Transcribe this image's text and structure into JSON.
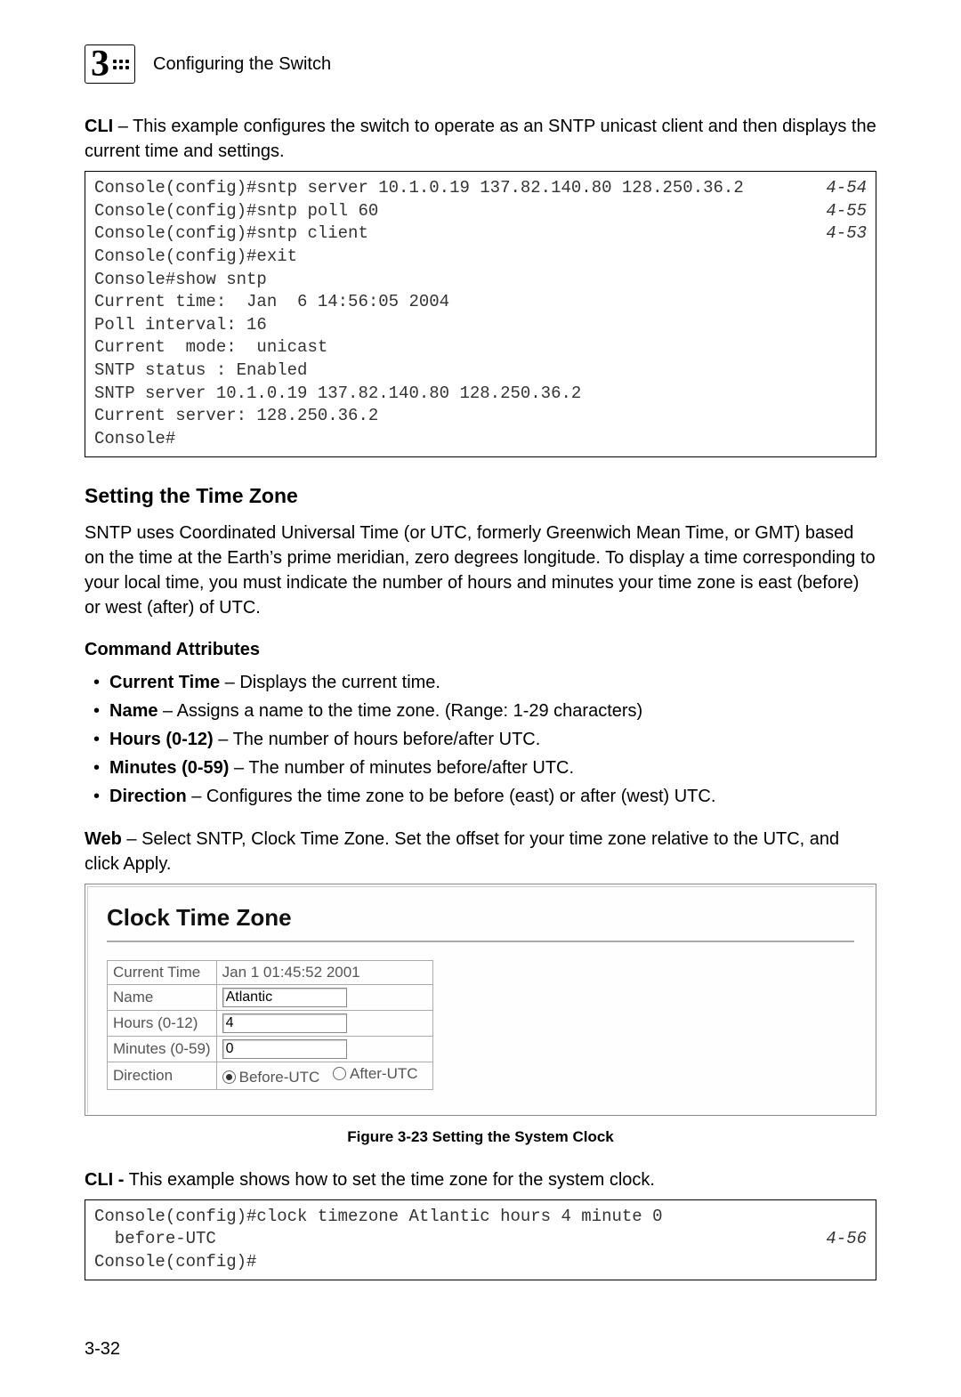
{
  "header": {
    "chapter_number": "3",
    "chapter_title": "Configuring the Switch"
  },
  "intro1_label": "CLI",
  "intro1_text": " – This example configures the switch to operate as an SNTP unicast client and then displays the current time and settings.",
  "code1": {
    "lines": [
      {
        "cmd": "Console(config)#sntp server 10.1.0.19 137.82.140.80 128.250.36.2",
        "ref": "4-54"
      },
      {
        "cmd": "Console(config)#sntp poll 60",
        "ref": "4-55"
      },
      {
        "cmd": "Console(config)#sntp client",
        "ref": "4-53"
      },
      {
        "cmd": "Console(config)#exit",
        "ref": ""
      },
      {
        "cmd": "Console#show sntp",
        "ref": ""
      },
      {
        "cmd": "Current time:  Jan  6 14:56:05 2004",
        "ref": ""
      },
      {
        "cmd": "Poll interval: 16",
        "ref": ""
      },
      {
        "cmd": "Current  mode:  unicast",
        "ref": ""
      },
      {
        "cmd": "SNTP status : Enabled",
        "ref": ""
      },
      {
        "cmd": "SNTP server 10.1.0.19 137.82.140.80 128.250.36.2",
        "ref": ""
      },
      {
        "cmd": "Current server: 128.250.36.2",
        "ref": ""
      },
      {
        "cmd": "Console#",
        "ref": ""
      }
    ]
  },
  "section_heading": "Setting the Time Zone",
  "section_body": "SNTP uses Coordinated Universal Time (or UTC, formerly Greenwich Mean Time, or GMT) based on the time at the Earth’s prime meridian, zero degrees longitude. To display a time corresponding to your local time, you must indicate the number of hours and minutes your time zone is east (before) or west (after) of UTC.",
  "attrs_heading": "Command Attributes",
  "attrs": [
    {
      "label": "Current Time",
      "text": " – Displays the current time."
    },
    {
      "label": "Name",
      "text": " – Assigns a name to the time zone. (Range: 1-29 characters)"
    },
    {
      "label": "Hours (0-12)",
      "text": " – The number of hours before/after UTC."
    },
    {
      "label": "Minutes (0-59)",
      "text": " – The number of minutes before/after UTC."
    },
    {
      "label": "Direction",
      "text": " – Configures the time zone to be before (east) or after (west) UTC."
    }
  ],
  "web_label": "Web",
  "web_text": " – Select SNTP, Clock Time Zone. Set the offset for your time zone relative to the UTC, and click Apply.",
  "panel": {
    "title": "Clock Time Zone",
    "rows": {
      "current_time_label": "Current Time",
      "current_time_value": "Jan 1 01:45:52 2001",
      "name_label": "Name",
      "name_value": "Atlantic",
      "hours_label": "Hours (0-12)",
      "hours_value": "4",
      "minutes_label": "Minutes (0-59)",
      "minutes_value": "0",
      "direction_label": "Direction",
      "direction_before": "Before-UTC",
      "direction_after": "After-UTC",
      "direction_selected": "before"
    }
  },
  "figure_caption": "Figure 3-23  Setting the System Clock",
  "cli2_label": "CLI -",
  "cli2_text": " This example shows how to set the time zone for the system clock.",
  "code2": {
    "lines": [
      {
        "cmd": "Console(config)#clock timezone Atlantic hours 4 minute 0",
        "ref": ""
      },
      {
        "cmd": "  before-UTC",
        "ref": "4-56"
      },
      {
        "cmd": "Console(config)#",
        "ref": ""
      }
    ]
  },
  "page_number": "3-32"
}
